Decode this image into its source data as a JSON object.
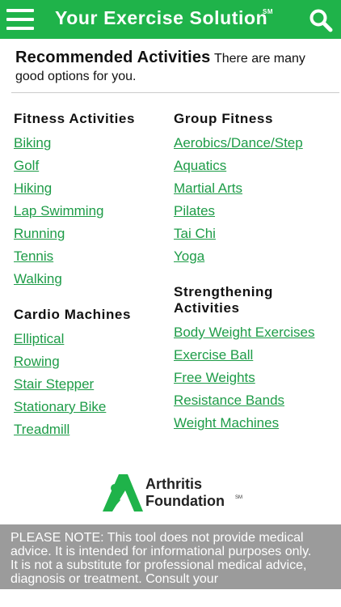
{
  "header": {
    "title": "Your Exercise Solution",
    "service_mark": "SM",
    "menu_icon": "hamburger-menu-icon",
    "search_icon": "search-icon",
    "bg_color": "#1fb34a"
  },
  "heading": {
    "title": "Recommended Activities",
    "subtitle": "There are many good options for you."
  },
  "sections": {
    "fitness": {
      "title": "Fitness Activities",
      "items": [
        "Biking",
        "Golf",
        "Hiking",
        "Lap Swimming",
        "Running",
        "Tennis",
        "Walking"
      ]
    },
    "cardio": {
      "title": "Cardio Machines",
      "items": [
        "Elliptical",
        "Rowing",
        "Stair Stepper",
        "Stationary Bike",
        "Treadmill"
      ]
    },
    "group": {
      "title": "Group Fitness",
      "items": [
        "Aerobics/Dance/Step",
        "Aquatics",
        "Martial Arts",
        "Pilates",
        "Tai Chi",
        "Yoga"
      ]
    },
    "strength": {
      "title": "Strengthening Activities",
      "items": [
        "Body Weight Exercises",
        "Exercise Ball",
        "Free Weights",
        "Resistance Bands",
        "Weight Machines"
      ]
    }
  },
  "logo": {
    "line1": "Arthritis",
    "line2": "Foundation",
    "tm": "SM"
  },
  "notice": {
    "text": "PLEASE NOTE: This tool does not provide medical advice. It is intended for informational purposes only. It is not a substitute for professional medical advice, diagnosis or treatment. Consult your"
  },
  "colors": {
    "link": "#1e9c48",
    "notice_bg": "#9b9b9b"
  }
}
